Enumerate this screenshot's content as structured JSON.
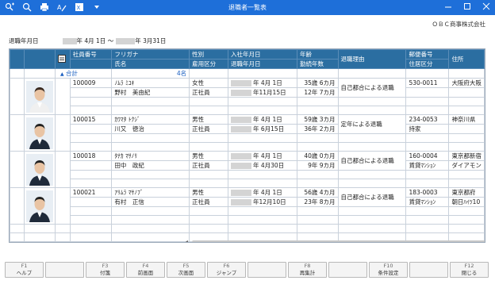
{
  "window": {
    "title": "退職者一覧表",
    "controls": [
      "minimize-icon",
      "maximize-icon",
      "close-icon"
    ]
  },
  "toolbar": {
    "icons": [
      "zoom-in-icon",
      "zoom-search-icon",
      "print-icon",
      "tool-icon",
      "export-icon",
      "dropdown-icon"
    ]
  },
  "company": "ＯＢＣ商事株式会社",
  "period": {
    "label": "退職年月日",
    "start_suffix": "年 4月 1日 ～",
    "end_suffix": "年 3月31日"
  },
  "columns": {
    "employee_no": "社員番号",
    "furigana": "フリガナ",
    "name": "氏名",
    "gender": "性別",
    "employment_type": "雇用区分",
    "hire_date": "入社年月日",
    "retire_date": "退職年月日",
    "age": "年齢",
    "tenure": "勤続年数",
    "reason": "退職理由",
    "postal": "郵便番号",
    "house_type": "住居区分",
    "address": "住所"
  },
  "summary": {
    "label": "合計",
    "count": "4名"
  },
  "employees": [
    {
      "no": "100009",
      "kana": "ﾉﾑﾗ ﾐﾕｷ",
      "name": "野村　美由紀",
      "gender": "女性",
      "type": "正社員",
      "hire": "年 4月 1日",
      "retire": "年11月15日",
      "age": "35歳 6カ月",
      "tenure": "12年 7カ月",
      "reason": "自己都合による退職",
      "postal": "530-0011",
      "house": "",
      "address": "大阪府大阪"
    },
    {
      "no": "100015",
      "kana": "ｶﾜﾏﾀ ﾄｸｼﾞ",
      "name": "川又　徳治",
      "gender": "男性",
      "type": "正社員",
      "hire": "年 4月 1日",
      "retire": "年 6月15日",
      "age": "59歳 3カ月",
      "tenure": "36年 2カ月",
      "reason": "定年による退職",
      "postal": "234-0053",
      "house": "持家",
      "address": "神奈川県"
    },
    {
      "no": "100018",
      "kana": "ﾀﾅｶ ﾏｻﾉﾘ",
      "name": "田中　政紀",
      "gender": "男性",
      "type": "正社員",
      "hire": "年 4月 1日",
      "retire": "年 4月30日",
      "age": "40歳 0カ月",
      "tenure": "9年 9カ月",
      "reason": "自己都合による退職",
      "postal": "160-0004",
      "house": "賃貸ﾏﾝｼｮﾝ",
      "address": "東京都新宿 ダイアモン"
    },
    {
      "no": "100021",
      "kana": "ｱﾘﾑﾗ ﾏｻﾉﾌﾞ",
      "name": "有村　正信",
      "gender": "男性",
      "type": "正社員",
      "hire": "年 4月 1日",
      "retire": "年12月10日",
      "age": "56歳 4カ月",
      "tenure": "23年 8カ月",
      "reason": "自己都合による退職",
      "postal": "183-0003",
      "house": "賃貸ﾏﾝｼｮﾝ",
      "address": "東京都府 朝日ﾊｲﾂ10"
    }
  ],
  "fkeys": [
    {
      "fn": "F1",
      "label": "ヘルプ"
    },
    {
      "fn": "",
      "label": ""
    },
    {
      "fn": "F3",
      "label": "付箋"
    },
    {
      "fn": "F4",
      "label": "前画面"
    },
    {
      "fn": "F5",
      "label": "次画面"
    },
    {
      "fn": "F6",
      "label": "ジャンプ"
    },
    {
      "fn": "",
      "label": ""
    },
    {
      "fn": "F8",
      "label": "再集計"
    },
    {
      "fn": "",
      "label": ""
    },
    {
      "fn": "F10",
      "label": "条件設定"
    },
    {
      "fn": "",
      "label": ""
    },
    {
      "fn": "F12",
      "label": "閉じる"
    }
  ]
}
